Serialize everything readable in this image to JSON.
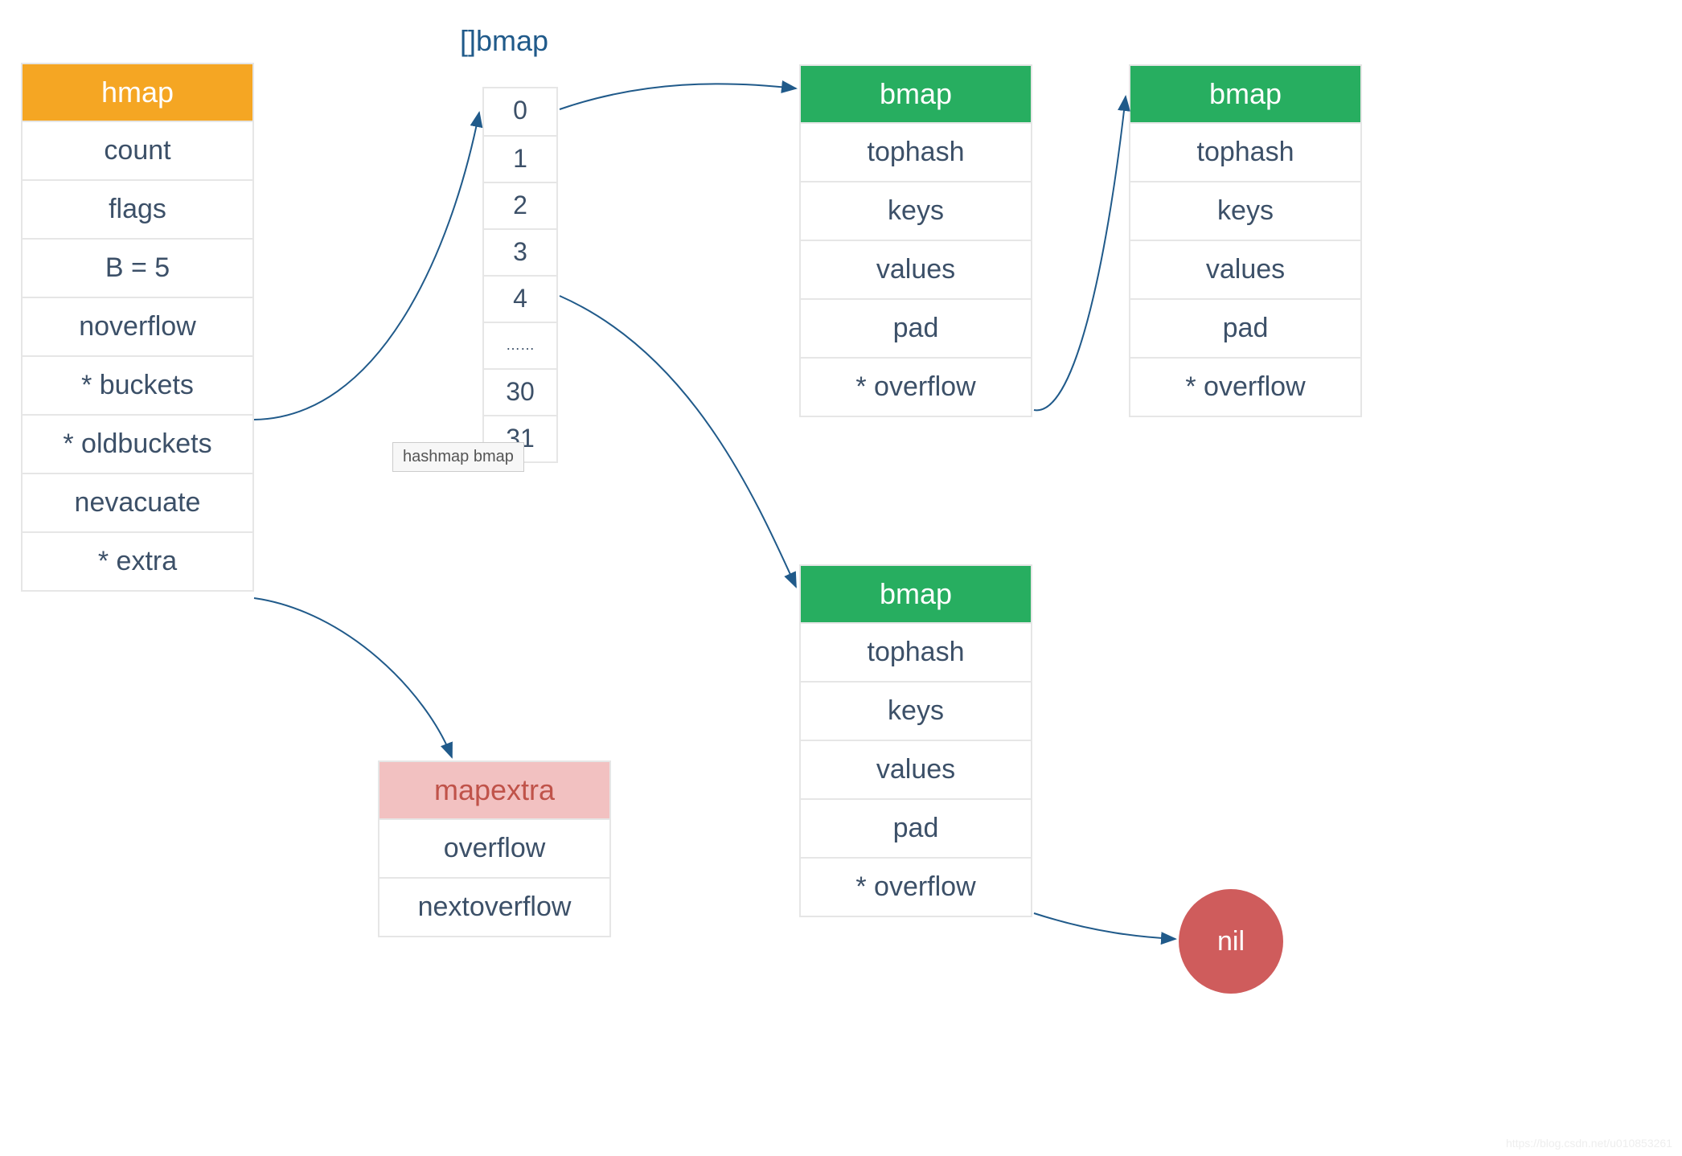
{
  "hmap": {
    "title": "hmap",
    "fields": [
      "count",
      "flags",
      "B = 5",
      "noverflow",
      "* buckets",
      "* oldbuckets",
      "nevacuate",
      "* extra"
    ]
  },
  "slice": {
    "label": "[]bmap",
    "cells": [
      "0",
      "1",
      "2",
      "3",
      "4",
      "……",
      "30",
      "31"
    ]
  },
  "tooltip": "hashmap bmap",
  "bmap1": {
    "title": "bmap",
    "fields": [
      "tophash",
      "keys",
      "values",
      "pad",
      "* overflow"
    ]
  },
  "bmap2": {
    "title": "bmap",
    "fields": [
      "tophash",
      "keys",
      "values",
      "pad",
      "* overflow"
    ]
  },
  "bmap3": {
    "title": "bmap",
    "fields": [
      "tophash",
      "keys",
      "values",
      "pad",
      "* overflow"
    ]
  },
  "mapextra": {
    "title": "mapextra",
    "fields": [
      "overflow",
      "nextoverflow"
    ]
  },
  "nil": "nil",
  "watermark": "https://blog.csdn.net/u010853261"
}
